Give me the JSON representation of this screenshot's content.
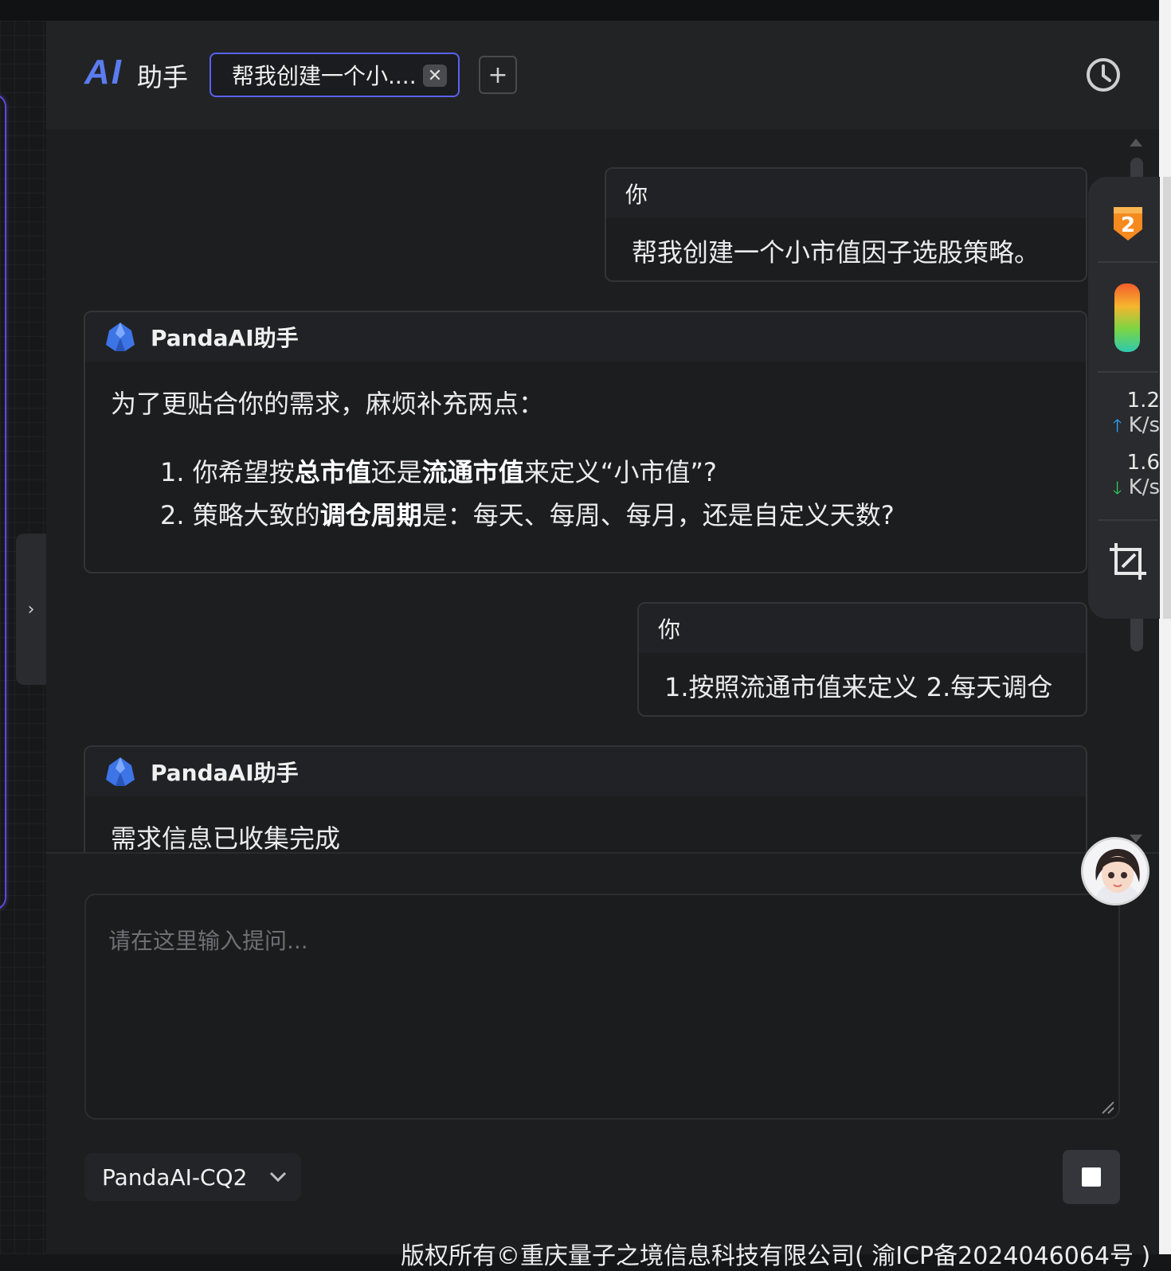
{
  "header": {
    "logo": "AI",
    "title": "助手",
    "tab_label": "帮我创建一个小....",
    "close_symbol": "✕",
    "add_symbol": "+"
  },
  "messages": [
    {
      "sender": "你",
      "text": "帮我创建一个小市值因子选股策略。"
    },
    {
      "sender": "PandaAI助手",
      "intro": "为了更贴合你的需求，麻烦补充两点：",
      "items": [
        {
          "num": "1. ",
          "a": "你希望按",
          "b1": "总市值",
          "c": "还是",
          "b2": "流通市值",
          "d": "来定义“小市值”?"
        },
        {
          "num": "2. ",
          "a": "策略大致的",
          "b1": "调仓周期",
          "c": "是：每天、每周、每月，还是自定义天数?"
        }
      ]
    },
    {
      "sender": "你",
      "text": "1.按照流通市值来定义 2.每天调仓"
    },
    {
      "sender": "PandaAI助手",
      "text": "需求信息已收集完成"
    }
  ],
  "monitor": {
    "badge_number": "2",
    "upload_value": "1.2",
    "upload_unit": "K/s",
    "download_value": "1.6",
    "download_unit": "K/s",
    "arrow_up": "🡑",
    "arrow_down": "🡓"
  },
  "input": {
    "placeholder": "请在这里输入提问..."
  },
  "model_select": {
    "selected": "PandaAI-CQ2"
  },
  "sidebar_toggle": "›",
  "footer": "版权所有©重庆量子之境信息科技有限公司( 渝ICP备2024046064号 )",
  "colors": {
    "accent": "#5a61ef",
    "panel": "#1d1e20",
    "header": "#222325"
  }
}
